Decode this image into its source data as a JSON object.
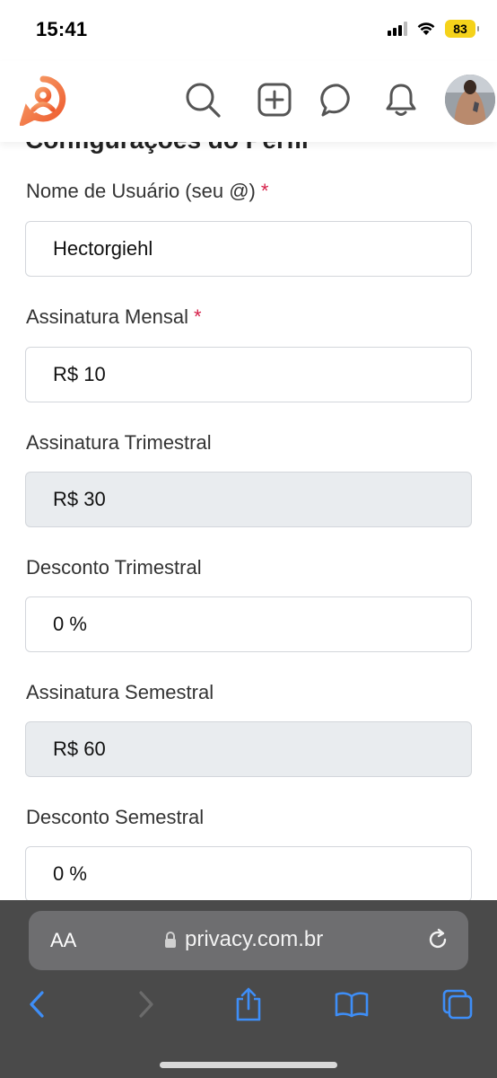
{
  "status_bar": {
    "time": "15:41",
    "battery": "83",
    "icons": [
      "signal-icon",
      "wifi-icon",
      "battery-icon"
    ]
  },
  "header": {
    "logo": "privacy-logo",
    "icons": [
      "search-icon",
      "add-post-icon",
      "chat-icon",
      "notifications-icon",
      "avatar"
    ],
    "colors": {
      "logo_start": "#f7a26b",
      "logo_end": "#ee5a2e"
    }
  },
  "form": {
    "section_title": "Configurações do Perfil",
    "required_mark": "*",
    "fields": [
      {
        "label": "Nome de Usuário (seu @)",
        "required": true,
        "value": "Hectorgiehl",
        "disabled": false
      },
      {
        "label": "Assinatura Mensal",
        "required": true,
        "value": "R$ 10",
        "disabled": false
      },
      {
        "label": "Assinatura Trimestral",
        "required": false,
        "value": "R$ 30",
        "disabled": true
      },
      {
        "label": "Desconto Trimestral",
        "required": false,
        "value": "0 %",
        "disabled": false
      },
      {
        "label": "Assinatura Semestral",
        "required": false,
        "value": "R$ 60",
        "disabled": true
      },
      {
        "label": "Desconto Semestral",
        "required": false,
        "value": "0 %",
        "disabled": false
      }
    ]
  },
  "browser": {
    "text_size_label": "AA",
    "url": "privacy.com.br",
    "toolbar_icons": [
      "back-icon",
      "forward-icon",
      "share-icon",
      "bookmarks-icon",
      "tabs-icon",
      "reload-icon",
      "lock-icon"
    ],
    "colors": {
      "accent": "#3e8ef7",
      "bar": "#4a4a4a"
    }
  }
}
